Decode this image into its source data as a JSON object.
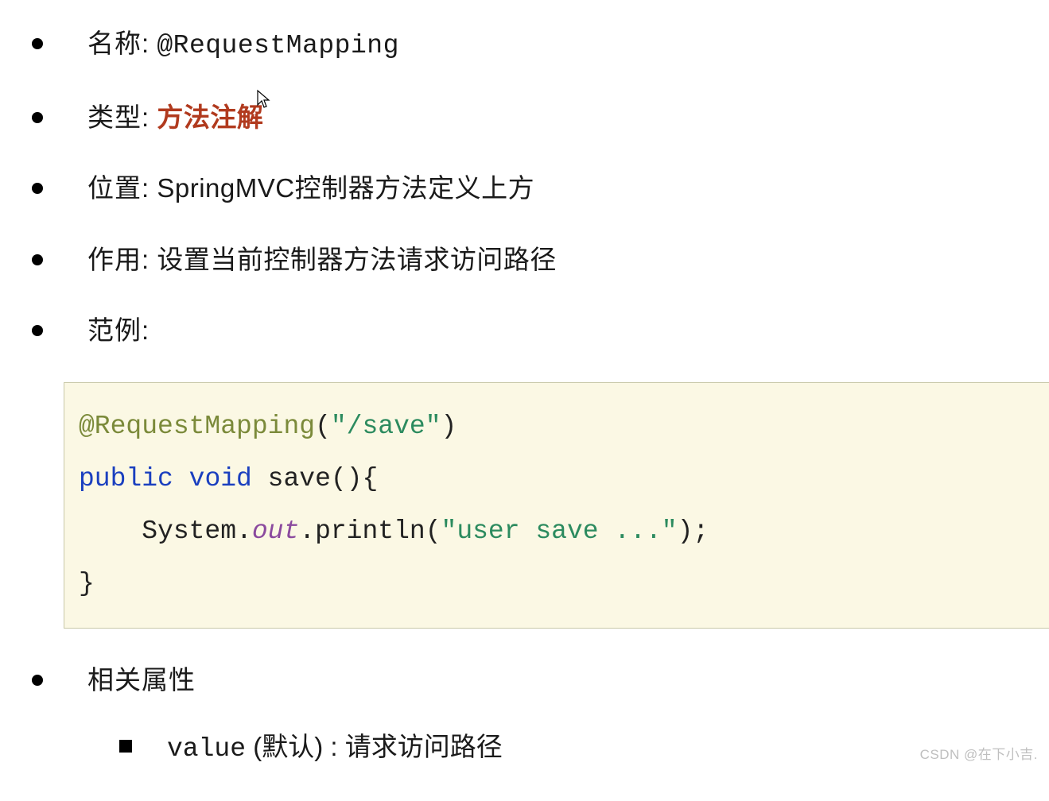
{
  "items": [
    {
      "label": "名称:",
      "value": "@RequestMapping",
      "mono": true
    },
    {
      "label": "类型:",
      "value": "方法注解",
      "emphasis": true
    },
    {
      "label": "位置:",
      "value": "SpringMVC控制器方法定义上方"
    },
    {
      "label": "作用:",
      "value": "设置当前控制器方法请求访问路径"
    },
    {
      "label": "范例:",
      "value": ""
    }
  ],
  "code": {
    "line1_annotation": "@RequestMapping",
    "line1_paren_open": "(",
    "line1_string": "\"/save\"",
    "line1_paren_close": ")",
    "line2_kw1": "public",
    "line2_kw2": "void",
    "line2_name": "save",
    "line2_parens": "()",
    "line2_brace": "{",
    "line3_indent": "    ",
    "line3_class": "System.",
    "line3_field": "out",
    "line3_dot": ".",
    "line3_method": "println",
    "line3_popen": "(",
    "line3_string": "\"user save ...\"",
    "line3_pclose": ")",
    "line3_semi": ";",
    "line4_brace": "}"
  },
  "related": {
    "label": "相关属性",
    "sub_value_mono": "value",
    "sub_value_default": " (默认) : ",
    "sub_value_desc": "请求访问路径"
  },
  "watermark": "CSDN @在下小吉."
}
